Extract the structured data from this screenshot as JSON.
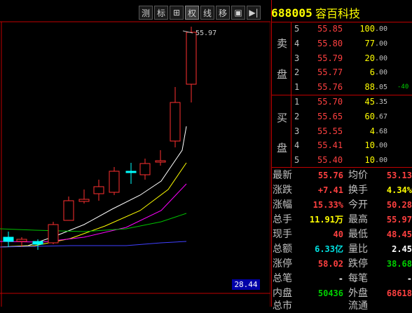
{
  "toolbar": {
    "buttons": [
      "测",
      "标",
      "⊞",
      "权",
      "线",
      "移",
      "▣",
      "▶|"
    ]
  },
  "chart": {
    "high_label": "55.97",
    "price_badge": "28.44",
    "colors": {
      "up": "#ff3030",
      "down": "#00ffff",
      "ma5": "#ffffff",
      "ma10": "#ffff00",
      "ma20": "#ff00ff",
      "ma30": "#00c000",
      "ma60": "#4040ff"
    }
  },
  "quote": {
    "code": "688005",
    "name": "容百科技"
  },
  "asks": {
    "side_label_1": "卖",
    "side_label_2": "盘",
    "levels": [
      {
        "level": "5",
        "price": "55.85",
        "vol_int": "100",
        "vol_dec": ".00",
        "delta": ""
      },
      {
        "level": "4",
        "price": "55.80",
        "vol_int": "77",
        "vol_dec": ".00",
        "delta": ""
      },
      {
        "level": "3",
        "price": "55.79",
        "vol_int": "20",
        "vol_dec": ".00",
        "delta": ""
      },
      {
        "level": "2",
        "price": "55.77",
        "vol_int": "6",
        "vol_dec": ".00",
        "delta": ""
      },
      {
        "level": "1",
        "price": "55.76",
        "vol_int": "88",
        "vol_dec": ".05",
        "delta": "-40"
      }
    ]
  },
  "bids": {
    "side_label_1": "买",
    "side_label_2": "盘",
    "levels": [
      {
        "level": "1",
        "price": "55.70",
        "vol_int": "45",
        "vol_dec": ".35"
      },
      {
        "level": "2",
        "price": "55.65",
        "vol_int": "60",
        "vol_dec": ".67"
      },
      {
        "level": "3",
        "price": "55.55",
        "vol_int": "4",
        "vol_dec": ".68"
      },
      {
        "level": "4",
        "price": "55.41",
        "vol_int": "10",
        "vol_dec": ".00"
      },
      {
        "level": "5",
        "price": "55.40",
        "vol_int": "10",
        "vol_dec": ".00"
      }
    ]
  },
  "stats": [
    {
      "l1": "最新",
      "v1": "55.76",
      "c1": "red",
      "l2": "均价",
      "v2": "53.13",
      "c2": "red"
    },
    {
      "l1": "涨跌",
      "v1": "+7.41",
      "c1": "red",
      "l2": "换手",
      "v2": "4.34%",
      "c2": "yellow"
    },
    {
      "l1": "涨幅",
      "v1": "15.33%",
      "c1": "red",
      "l2": "今开",
      "v2": "50.28",
      "c2": "red"
    },
    {
      "l1": "总手",
      "v1": "11.91万",
      "c1": "yellow",
      "l2": "最高",
      "v2": "55.97",
      "c2": "red"
    },
    {
      "l1": "现手",
      "v1": "40",
      "c1": "red",
      "l2": "最低",
      "v2": "48.45",
      "c2": "red"
    },
    {
      "l1": "总额",
      "v1": "6.33亿",
      "c1": "cyan",
      "l2": "量比",
      "v2": "2.45",
      "c2": "white"
    },
    {
      "l1": "涨停",
      "v1": "58.02",
      "c1": "red",
      "l2": "跌停",
      "v2": "38.68",
      "c2": "green"
    },
    {
      "l1": "总笔",
      "v1": "-",
      "c1": "white",
      "l2": "每笔",
      "v2": "-",
      "c2": "white"
    },
    {
      "l1": "内盘",
      "v1": "50436",
      "c1": "green",
      "l2": "外盘",
      "v2": "68618",
      "c2": "red"
    }
  ],
  "bottom_partial": {
    "l1": "总市",
    "l2": "流通"
  }
}
